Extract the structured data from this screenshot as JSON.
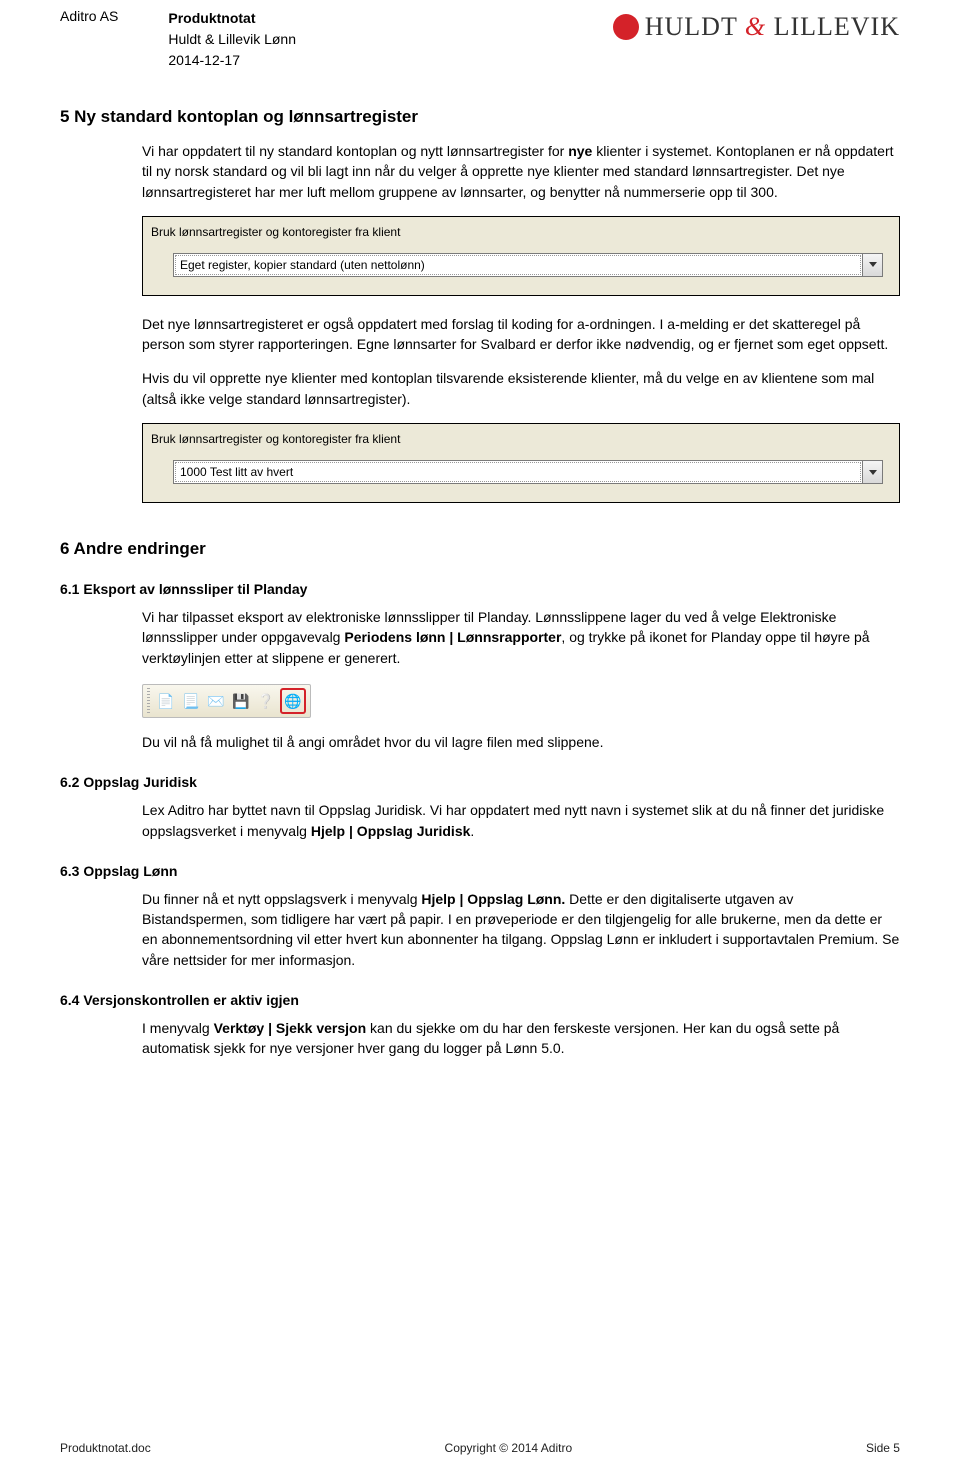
{
  "header": {
    "company": "Aditro AS",
    "doc_title": "Produktnotat",
    "product": "Huldt & Lillevik Lønn",
    "date": "2014-12-17",
    "logo_left": "HULDT",
    "logo_amp": "&",
    "logo_right": "LILLEVIK"
  },
  "sec5": {
    "title": "5 Ny standard kontoplan og lønnsartregister",
    "p1a": "Vi har oppdatert til ny standard kontoplan og nytt lønnsartregister for ",
    "p1b": "nye",
    "p1c": " klienter i systemet. Kontoplanen er nå oppdatert til ny norsk standard og vil bli lagt inn når du velger å opprette nye klienter med standard lønnsartregister. Det nye lønnsartregisteret har mer luft mellom gruppene av lønnsarter, og benytter nå nummerserie opp til 300.",
    "shot1": {
      "label": "Bruk lønnsartregister og  kontoregister fra klient",
      "value": "Eget register, kopier standard (uten nettolønn)"
    },
    "p2": "Det nye lønnsartregisteret er også oppdatert med forslag til koding for a-ordningen. I a-melding er det skatteregel på person som styrer rapporteringen. Egne lønnsarter for Svalbard er derfor ikke nødvendig, og er fjernet som eget oppsett.",
    "p3": "Hvis du vil opprette nye klienter med kontoplan tilsvarende eksisterende klienter, må du velge en av klientene som mal (altså ikke velge standard lønnsartregister).",
    "shot2": {
      "label": "Bruk lønnsartregister og  kontoregister fra klient",
      "value": "1000 Test litt av hvert"
    }
  },
  "sec6": {
    "title": "6 Andre endringer",
    "s61": {
      "title": "6.1 Eksport av lønnssliper til Planday",
      "p1a": "Vi har tilpasset eksport av elektroniske lønnsslipper til Planday. Lønnsslippene lager du ved å velge Elektroniske lønnsslipper under oppgavevalg ",
      "p1b": "Periodens lønn | Lønnsrapporter",
      "p1c": ", og trykke på ikonet for Planday oppe til høyre på verktøylinjen etter at slippene er generert.",
      "p2": "Du vil nå få mulighet til å angi området hvor du vil lagre filen med slippene."
    },
    "s62": {
      "title": "6.2 Oppslag Juridisk",
      "p1a": "Lex Aditro har byttet navn til Oppslag Juridisk. Vi har oppdatert med nytt navn i systemet slik at du nå finner det juridiske oppslagsverket i menyvalg ",
      "p1b": "Hjelp | Oppslag Juridisk",
      "p1c": "."
    },
    "s63": {
      "title": "6.3 Oppslag Lønn",
      "p1a": "Du finner nå et nytt oppslagsverk i menyvalg ",
      "p1b": "Hjelp | Oppslag Lønn.",
      "p1c": " Dette er den digitaliserte utgaven av Bistandspermen, som tidligere har vært på papir. I en prøveperiode er den tilgjengelig for alle brukerne, men da dette er en abonnementsordning vil etter hvert kun abonnenter ha tilgang. Oppslag Lønn er inkludert i supportavtalen Premium. Se våre nettsider for mer informasjon."
    },
    "s64": {
      "title": "6.4 Versjonskontrollen er aktiv igjen",
      "p1a": "I menyvalg ",
      "p1b": "Verktøy | Sjekk versjon",
      "p1c": " kan du sjekke om du har den ferskeste versjonen. Her kan du også sette på automatisk sjekk for nye versjoner hver gang du logger på Lønn 5.0."
    }
  },
  "toolbar": {
    "icons": {
      "doc": "📄",
      "page": "📃",
      "mail": "✉️",
      "save": "💾",
      "help": "❔",
      "globe": "🌐"
    }
  },
  "footer": {
    "left": "Produktnotat.doc",
    "center": "Copyright © 2014 Aditro",
    "right": "Side 5"
  }
}
